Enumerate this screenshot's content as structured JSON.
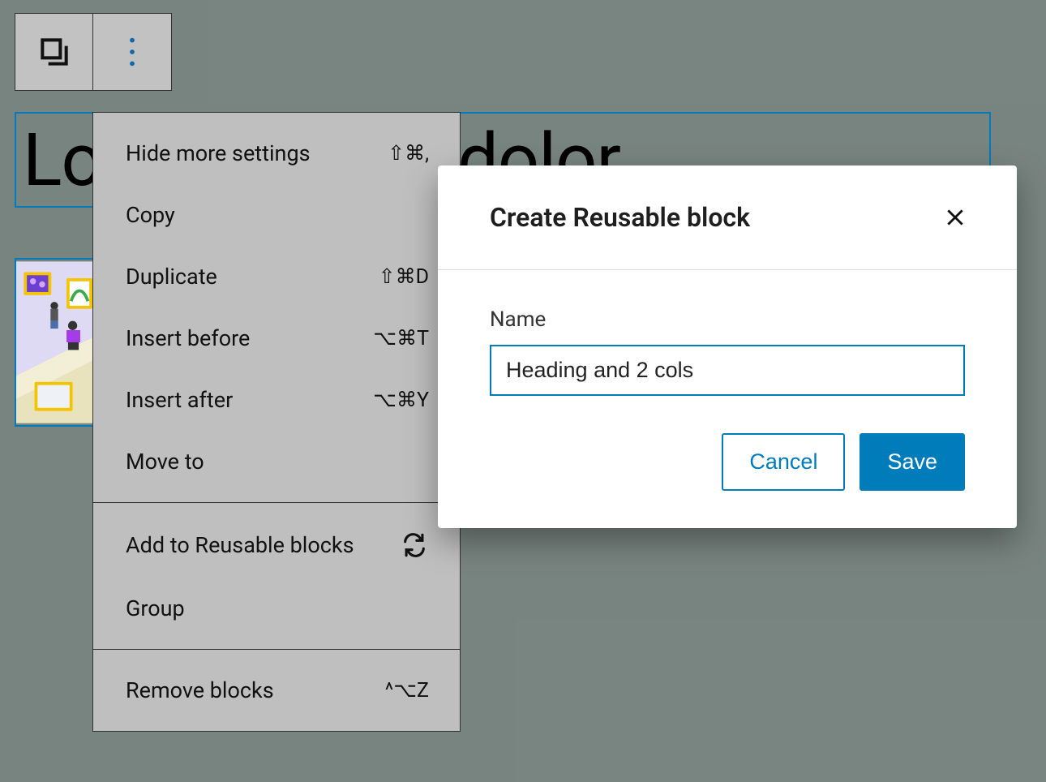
{
  "heading": {
    "text": "Lorem ipsum dolor"
  },
  "toolbar": {},
  "dropdown": {
    "section1": [
      {
        "label": "Hide more settings",
        "shortcut": "⇧⌘,"
      },
      {
        "label": "Copy",
        "shortcut": ""
      },
      {
        "label": "Duplicate",
        "shortcut": "⇧⌘D"
      },
      {
        "label": "Insert before",
        "shortcut": "⌥⌘T"
      },
      {
        "label": "Insert after",
        "shortcut": "⌥⌘Y"
      },
      {
        "label": "Move to",
        "shortcut": ""
      }
    ],
    "section2": [
      {
        "label": "Add to Reusable blocks",
        "shortcut_icon": "reusable"
      },
      {
        "label": "Group",
        "shortcut": ""
      }
    ],
    "section3": [
      {
        "label": "Remove blocks",
        "shortcut": "^⌥Z"
      }
    ]
  },
  "modal": {
    "title": "Create Reusable block",
    "name_label": "Name",
    "name_value": "Heading and 2 cols",
    "cancel": "Cancel",
    "save": "Save"
  }
}
